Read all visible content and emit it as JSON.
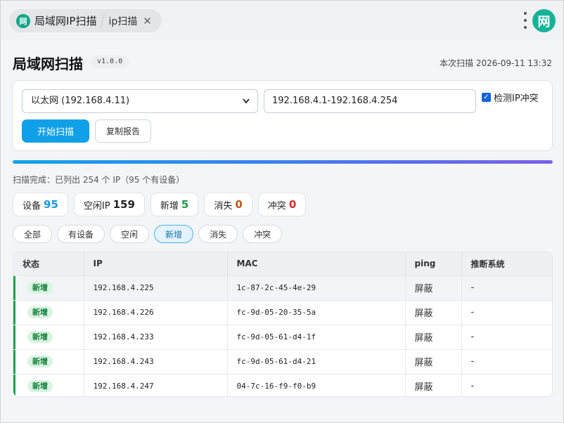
{
  "tabs": [
    {
      "icon": "网",
      "label": "局域网IP扫描"
    },
    {
      "label": "ip扫描",
      "close": "✕"
    }
  ],
  "app_badge": "网",
  "header": {
    "title": "局域网扫描",
    "version": "v1.0.0",
    "scan_time": "本次扫描 2026-09-11 13:32"
  },
  "controls": {
    "interface": "以太网 (192.168.4.11)",
    "ip_range": "192.168.4.1-192.168.4.254",
    "conflict_label": "检测IP冲突",
    "conflict_checked": true,
    "scan_button": "开始扫描",
    "copy_button": "复制报告"
  },
  "progress": {
    "percent": 100,
    "status": "扫描完成：已列出 254 个 IP（95 个有设备）"
  },
  "stats": [
    {
      "label": "设备",
      "value": "95",
      "color": "#1a9ad6"
    },
    {
      "label": "空闲IP",
      "value": "159",
      "color": "#222222"
    },
    {
      "label": "新增",
      "value": "5",
      "color": "#1e9a46"
    },
    {
      "label": "消失",
      "value": "0",
      "color": "#c2561a"
    },
    {
      "label": "冲突",
      "value": "0",
      "color": "#d12b2b"
    }
  ],
  "filters": [
    {
      "label": "全部",
      "active": false
    },
    {
      "label": "有设备",
      "active": false
    },
    {
      "label": "空闲",
      "active": false
    },
    {
      "label": "新增",
      "active": true
    },
    {
      "label": "消失",
      "active": false
    },
    {
      "label": "冲突",
      "active": false
    }
  ],
  "table": {
    "columns": [
      "状态",
      "IP",
      "MAC",
      "ping",
      "推断系统"
    ],
    "rows": [
      {
        "status": "新增",
        "ip": "192.168.4.225",
        "mac": "1c-87-2c-45-4e-29",
        "ping": "屏蔽",
        "os": "-"
      },
      {
        "status": "新增",
        "ip": "192.168.4.226",
        "mac": "fc-9d-05-20-35-5a",
        "ping": "屏蔽",
        "os": "-"
      },
      {
        "status": "新增",
        "ip": "192.168.4.233",
        "mac": "fc-9d-05-61-d4-1f",
        "ping": "屏蔽",
        "os": "-"
      },
      {
        "status": "新增",
        "ip": "192.168.4.243",
        "mac": "fc-9d-05-61-d4-21",
        "ping": "屏蔽",
        "os": "-"
      },
      {
        "status": "新增",
        "ip": "192.168.4.247",
        "mac": "04-7c-16-f9-f0-b9",
        "ping": "屏蔽",
        "os": "-"
      }
    ]
  }
}
